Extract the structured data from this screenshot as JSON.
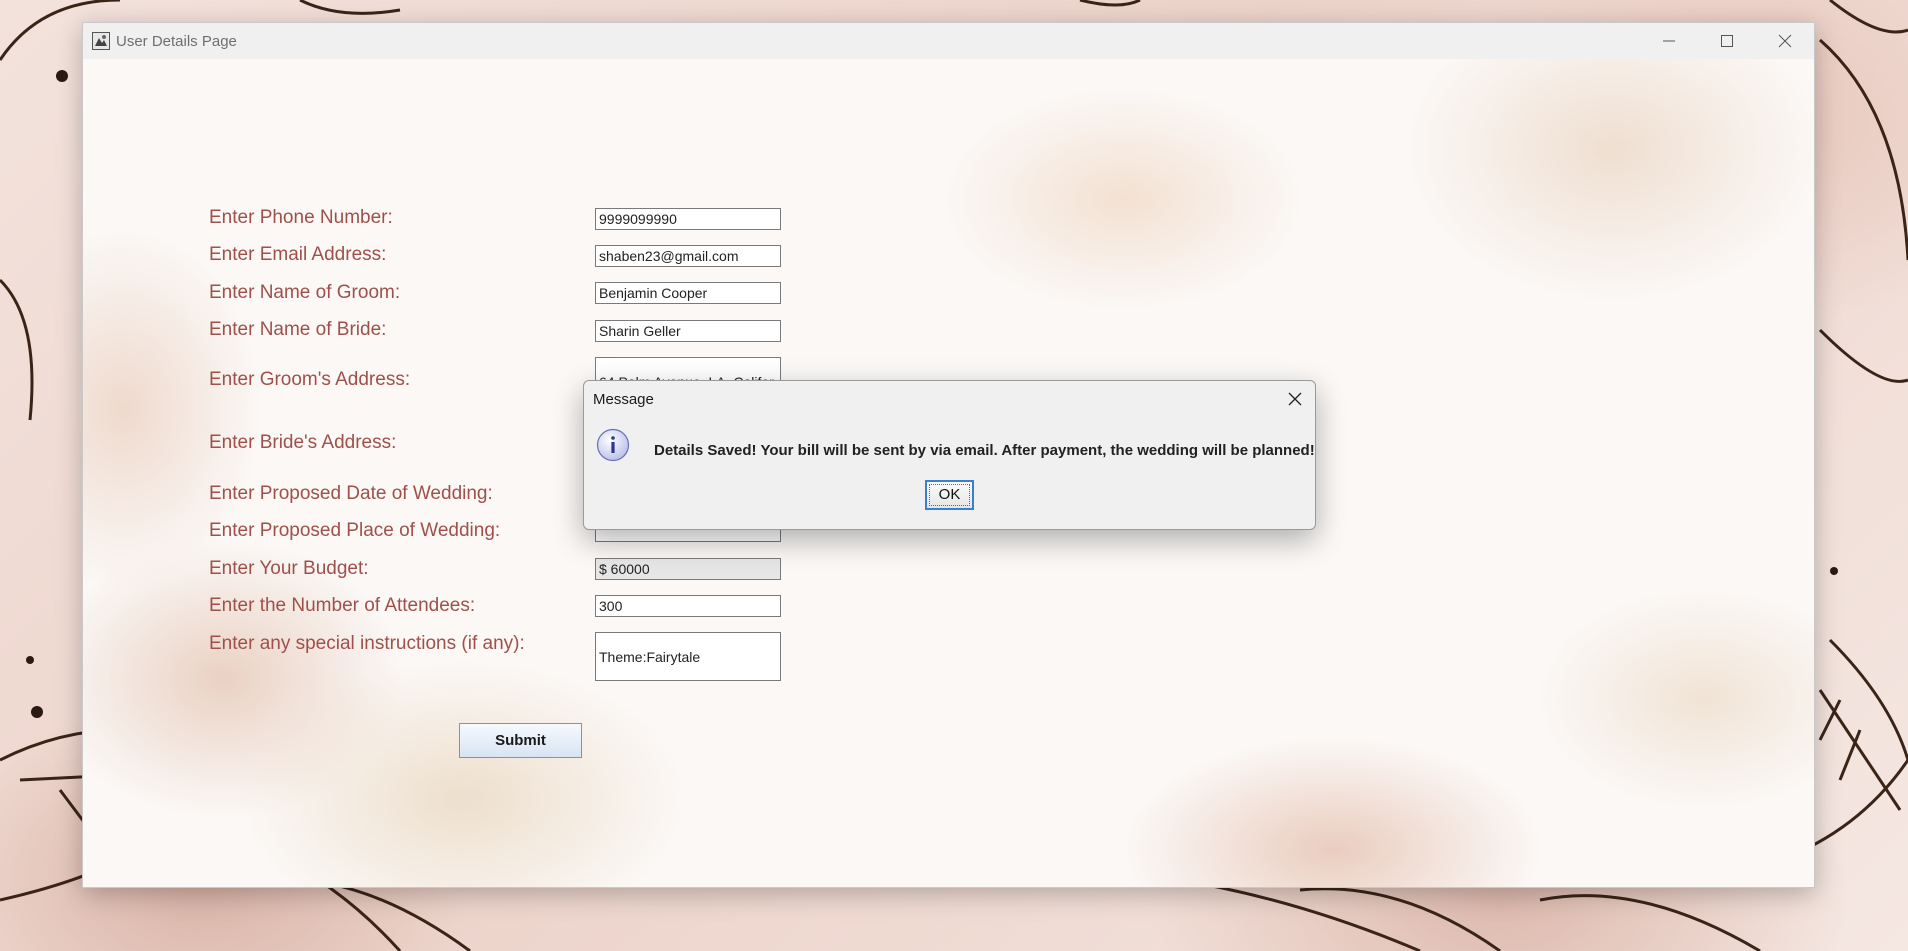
{
  "window": {
    "title": "User Details Page",
    "controls": [
      "minimize-icon",
      "maximize-icon",
      "close-icon"
    ]
  },
  "form": {
    "fields": [
      {
        "label": "Enter Phone Number:",
        "value": "9999099990"
      },
      {
        "label": "Enter Email Address:",
        "value": "shaben23@gmail.com"
      },
      {
        "label": "Enter Name of Groom:",
        "value": "Benjamin Cooper"
      },
      {
        "label": "Enter Name of Bride:",
        "value": "Sharin Geller"
      },
      {
        "label": "Enter Groom's Address:",
        "value": "64 Palm Avenue, LA, Califor"
      },
      {
        "label": "Enter Bride's Address:",
        "value": ""
      },
      {
        "label": "Enter Proposed Date of Wedding:",
        "value": ""
      },
      {
        "label": "Enter Proposed Place of Wedding:",
        "value": ""
      },
      {
        "label": "Enter Your Budget:",
        "value": "$ 60000"
      },
      {
        "label": "Enter the Number of Attendees:",
        "value": "300"
      },
      {
        "label": "Enter any special instructions (if any):",
        "value": "Theme:Fairytale"
      }
    ],
    "submit_label": "Submit"
  },
  "dialog": {
    "title": "Message",
    "icon": "info-icon",
    "message": "Details Saved! Your bill will be sent by via email. After payment, the wedding will be planned!",
    "ok_label": "OK"
  },
  "colors": {
    "label": "#a0504a",
    "dialog_bg": "#f0f0f0",
    "focus_border": "#3c7fd1"
  }
}
